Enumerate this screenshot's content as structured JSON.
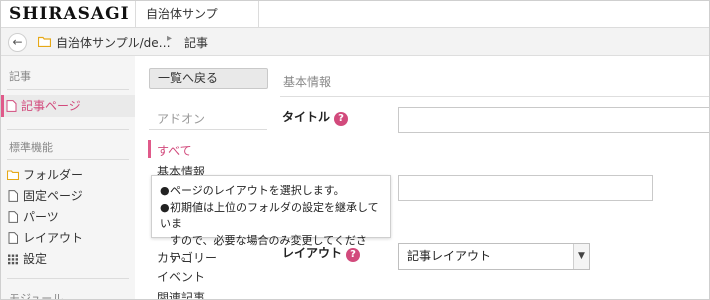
{
  "header": {
    "logo": "SHIRASAGI",
    "site_tab": "自治体サンプル/demo"
  },
  "breadcrumb": {
    "back_icon": "arrow-left-icon",
    "site": "自治体サンプル/de…",
    "separator": "▸",
    "page": "記事"
  },
  "sidebar": {
    "section1_head": "記事",
    "active_item": "記事ページ",
    "section2_head": "標準機能",
    "items": [
      {
        "label": "フォルダー",
        "icon": "folder-icon"
      },
      {
        "label": "固定ページ",
        "icon": "page-icon"
      },
      {
        "label": "パーツ",
        "icon": "page-icon"
      },
      {
        "label": "レイアウト",
        "icon": "page-icon"
      },
      {
        "label": "設定",
        "icon": "grid-icon"
      }
    ],
    "section3_head": "モジュール"
  },
  "main": {
    "back_button": "一覧へ戻る",
    "addon_head": "アドオン",
    "nav": {
      "all": "すべて",
      "basic": "基本情報",
      "category": "カテゴリー",
      "event": "イベント",
      "related": "関連記事"
    },
    "section_head": "基本情報",
    "fields": {
      "title_label": "タイトル",
      "title_value": "",
      "second_value": "",
      "layout_label": "レイアウト",
      "layout_value": "記事レイアウト"
    },
    "help_glyph": "?",
    "tooltip": {
      "line1": "ページのレイアウトを選択します。",
      "line2a": "初期値は上位のフォルダの設定を継承していま",
      "line2b": "すので、必要な場合のみ変更してください。"
    }
  },
  "colors": {
    "accent": "#d24a7c",
    "sidebar_bg": "#f5f5f5",
    "folder": "#e6a817"
  }
}
